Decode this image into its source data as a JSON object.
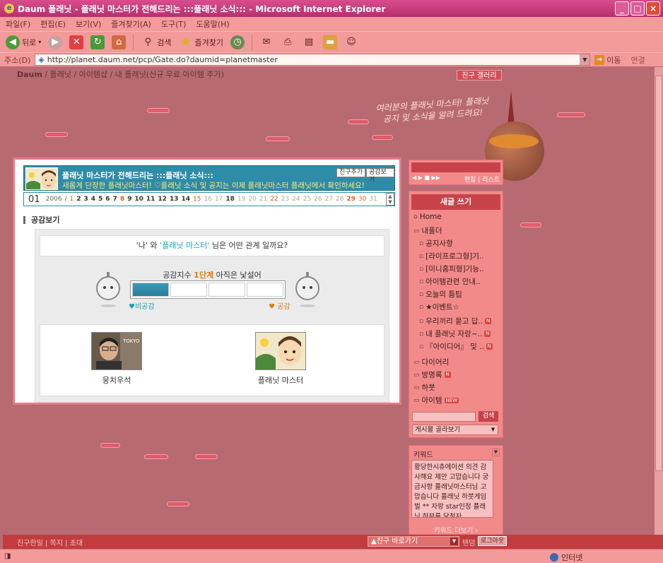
{
  "window": {
    "title": "Daum 플래닛 - 플래닛 마스터가 전해드리는 :::플래닛 소식::: - Microsoft Internet Explorer"
  },
  "menu": [
    "파일(F)",
    "편집(E)",
    "보기(V)",
    "즐겨찾기(A)",
    "도구(T)",
    "도움말(H)"
  ],
  "toolbar": {
    "back": "뒤로",
    "search": "검색",
    "favorites": "즐겨찾기"
  },
  "address": {
    "label": "주소(D)",
    "url": "http://planet.daum.net/pcp/Gate.do?daumid=planetmaster",
    "go": "이동",
    "links": "연결"
  },
  "breadcrumb": {
    "daum": "Daum",
    "rest": " / 플래닛 / 아이템샵 / 내 플래닛(신규 무료 아이템 추가)"
  },
  "friend_gallery": "친구 갤러리",
  "planet_message": "여러분의 플래닛 마스터! 플래닛 공지 및 소식을 알려 드려요!",
  "header": {
    "title": "플래닛 마스터가 전해드리는 :::플래닛 소식:::",
    "subtitle": "새롭게 단장한 플래닛마스터! ♡플래닛 소식 및 공지는 이제 플래닛마스터 플래닛에서 확인하세요!",
    "add_friend": "친구추가",
    "empathy_view": "공감보기"
  },
  "calendar": {
    "month": "01",
    "year": "2006",
    "days": [
      {
        "d": "1",
        "t": "sun"
      },
      {
        "d": "2",
        "t": "d"
      },
      {
        "d": "3",
        "t": "d"
      },
      {
        "d": "4",
        "t": "d"
      },
      {
        "d": "5",
        "t": "d"
      },
      {
        "d": "6",
        "t": "d"
      },
      {
        "d": "7",
        "t": "d"
      },
      {
        "d": "8",
        "t": "sat"
      },
      {
        "d": "9",
        "t": "d"
      },
      {
        "d": "10",
        "t": "d"
      },
      {
        "d": "11",
        "t": "d"
      },
      {
        "d": "12",
        "t": "d"
      },
      {
        "d": "13",
        "t": "d"
      },
      {
        "d": "14",
        "t": "d"
      },
      {
        "d": "15",
        "t": "sun"
      },
      {
        "d": "16",
        "t": "dim"
      },
      {
        "d": "17",
        "t": "dim"
      },
      {
        "d": "18",
        "t": "d"
      },
      {
        "d": "19",
        "t": "dim"
      },
      {
        "d": "20",
        "t": "dim"
      },
      {
        "d": "21",
        "t": "dim"
      },
      {
        "d": "22",
        "t": "sun"
      },
      {
        "d": "23",
        "t": "dim"
      },
      {
        "d": "24",
        "t": "dim"
      },
      {
        "d": "25",
        "t": "dim"
      },
      {
        "d": "26",
        "t": "dim"
      },
      {
        "d": "27",
        "t": "dim"
      },
      {
        "d": "28",
        "t": "dim"
      },
      {
        "d": "29",
        "t": "sat"
      },
      {
        "d": "30",
        "t": "sun"
      },
      {
        "d": "31",
        "t": "dim"
      }
    ]
  },
  "section_title": "공감보기",
  "empathy": {
    "q_me": "'나'",
    "q_and": " 와 ",
    "q_other": "'플래닛 마스터'",
    "q_tail": " 님은 어떤 관계 일까요?",
    "label_prefix": "공감지수 ",
    "level": "1단계",
    "label_suffix": " 아직은 낯설어",
    "gauge_level": 1,
    "gauge_total": 4,
    "non_empathy": "♥비공감",
    "yes_empathy": "♥ 공감"
  },
  "users": {
    "me": "뭉치우석",
    "other": "플래닛 마스터",
    "photo_text": "TOKYO TOWER"
  },
  "sidebar": {
    "player_links": "편집 | 리스트",
    "write": "새글 쓰기",
    "items": [
      {
        "label": "Home",
        "icon": "⌂",
        "sub": false,
        "badge": ""
      },
      {
        "label": "내폴더",
        "icon": "▭",
        "sub": false,
        "badge": ""
      },
      {
        "label": "공지사항",
        "icon": "▫",
        "sub": true,
        "badge": ""
      },
      {
        "label": "[라이프로그형]기..",
        "icon": "▫",
        "sub": true,
        "badge": ""
      },
      {
        "label": "[미니홈피형]기능..",
        "icon": "▫",
        "sub": true,
        "badge": ""
      },
      {
        "label": "아이템관련 안내..",
        "icon": "▫",
        "sub": true,
        "badge": ""
      },
      {
        "label": "오늘의 틈팁",
        "icon": "▫",
        "sub": true,
        "badge": ""
      },
      {
        "label": "★이벤트☆",
        "icon": "▫",
        "sub": true,
        "badge": ""
      },
      {
        "label": "우리끼리 묻고 답..",
        "icon": "▫",
        "sub": true,
        "badge": "N"
      },
      {
        "label": "내 플래닛 자랑~..",
        "icon": "▫",
        "sub": true,
        "badge": "N"
      },
      {
        "label": "『아이디어』 및 ..",
        "icon": "▫",
        "sub": true,
        "badge": "N"
      },
      {
        "label": "다이어리",
        "icon": "▭",
        "sub": false,
        "badge": ""
      },
      {
        "label": "방명록",
        "icon": "▭",
        "sub": false,
        "badge": "N"
      },
      {
        "label": "하붓",
        "icon": "▭",
        "sub": false,
        "badge": ""
      },
      {
        "label": "아이템",
        "icon": "▭",
        "sub": false,
        "badge": "NEW"
      }
    ],
    "search_btn": "검색",
    "select": "게시물 골라보기"
  },
  "keyword": {
    "title": "키워드",
    "content": "황당한시츄에이션 의견 감사해요 제안 고맙습니다 궁금사항 플래닛마스터님 고맙습니다 플래닛 하붓게임 벌 ** 자랑 star인정 플래닛 하부를 당첨자",
    "more": "키워드 더보기 ›"
  },
  "footer": {
    "links": "친구한일 | 쪽지 | 초대",
    "friend_select": "▲친구 바로가기",
    "tandem": "탠덤",
    "logout": "로그아웃"
  },
  "status": {
    "zone": "인터넷"
  }
}
